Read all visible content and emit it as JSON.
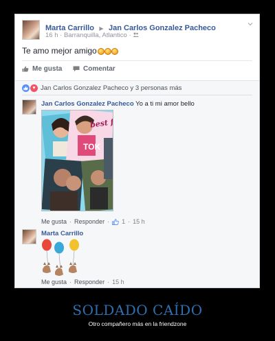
{
  "post": {
    "author": "Marta Carrillo",
    "arrow": "▶",
    "target": "Jan Carlos Gonzalez Pacheco",
    "time": "16 h",
    "location": "· Barranquilla, Atlantico ·",
    "text": "Te amo mejor amigo",
    "emojis": [
      "grin-emoji",
      "grin-emoji",
      "grin-emoji"
    ]
  },
  "actions": {
    "like": "Me gusta",
    "comment": "Comentar"
  },
  "reactions": {
    "summary": "Jan Carlos Gonzalez Pacheco y 3 personas más"
  },
  "comments": [
    {
      "author": "Jan Carlos Gonzalez Pacheco",
      "text": "Yo a ti mi amor bello",
      "photo_text": "best fr",
      "photo_text2": "TOK",
      "like": "Me gusta",
      "sep1": "·",
      "reply": "Responder",
      "sep2": "·",
      "likes": "1",
      "sep3": "·",
      "time": "15 h"
    },
    {
      "author": "Marta Carrillo",
      "sticker": "balloon-animals-sticker",
      "like": "Me gusta",
      "sep1": "·",
      "reply": "Responder",
      "sep2": "·",
      "time": "15 h"
    }
  ],
  "caption": {
    "title": "SOLDADO CAÍDO",
    "subtitle": "Otro compañero más en la friendzone"
  },
  "colors": {
    "link": "#365899",
    "caption_title": "#2f6fb0",
    "like_blue": "#5890ff",
    "love_red": "#f25268"
  }
}
